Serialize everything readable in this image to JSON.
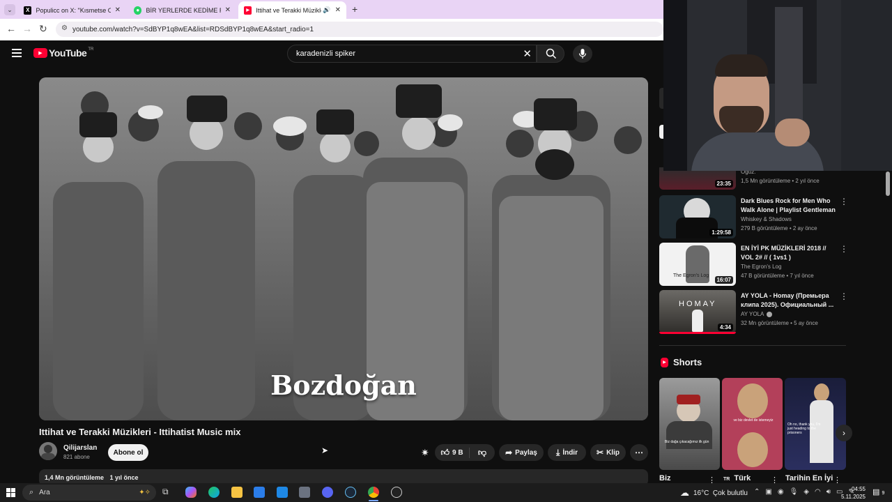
{
  "browser": {
    "tabs": [
      {
        "title": "Populicc on X: \"Kısmetse Olur: A",
        "icon": "x-icon"
      },
      {
        "title": "BİR YERLERDE KEDİME RASTLAR",
        "icon": "whatsapp-icon"
      },
      {
        "title": "Ittihat ve Terakki Müzikleri",
        "icon": "youtube-icon"
      }
    ],
    "url": "youtube.com/watch?v=SdBYP1q8wEA&list=RDSdBYP1q8wEA&start_radio=1"
  },
  "masthead": {
    "logo_text": "YouTube",
    "region": "TR",
    "search_value": "karadenizli spiker"
  },
  "video": {
    "caption": "Bozdoğan",
    "title": "Ittihat ve Terakki Müzikleri - Ittihatist Music mix",
    "channel": "Qilijarslan",
    "subscribers": "821 abone",
    "subscribe_label": "Abone ol",
    "likes": "9 B",
    "share_label": "Paylaş",
    "download_label": "İndir",
    "clip_label": "Klip",
    "views": "1,4 Mn görüntüleme",
    "age": "1 yıl önce"
  },
  "sidebar": {
    "partial_item": {
      "channel": "Oguz.",
      "meta": "1,5 Mn görüntüleme • 2 yıl önce",
      "duration": "23:35"
    },
    "items": [
      {
        "title": "Dark Blues Rock for Men Who Walk Alone | Playlist Gentleman",
        "channel": "Whiskey & Shadows",
        "meta": "279 B görüntüleme • 2 ay önce",
        "duration": "1:29:58"
      },
      {
        "title": "EN İYİ PK MÜZİKLERİ 2018 // VOL 2# // ( 1vs1 )",
        "channel": "The Egron's Log",
        "meta": "47 B görüntüleme • 7 yıl önce",
        "duration": "16:07",
        "thumb_text": "The Egron's Log"
      },
      {
        "title": "AY YOLA - Homay (Премьера клипа 2025). Официальный ...",
        "channel": "AY YOLA",
        "meta": "32 Mn görüntüleme • 5 ay önce",
        "duration": "4:34",
        "thumb_text": "HOMAY"
      }
    ],
    "shorts_heading": "Shorts",
    "shorts": [
      {
        "title": "Biz",
        "overlay": "Biz dağa çıkacağımız ilk gün"
      },
      {
        "title": "Türk",
        "overlay": "ve biz devlet de istemeyiz",
        "tag": "TR"
      },
      {
        "title": "Tarihin En İyi",
        "overlay": "Oh no, thank you, I'm just heading to the prisoners"
      }
    ]
  },
  "taskbar": {
    "search_placeholder": "Ara",
    "weather": "16°C  Çok bulutlu",
    "time": "04:55",
    "date": "5.11.2025",
    "notif_count": "9"
  },
  "colors": {
    "yt_red": "#ff0033",
    "tab_strip": "#e9d4f5",
    "bg": "#0f0f0f",
    "pill": "#272727"
  }
}
